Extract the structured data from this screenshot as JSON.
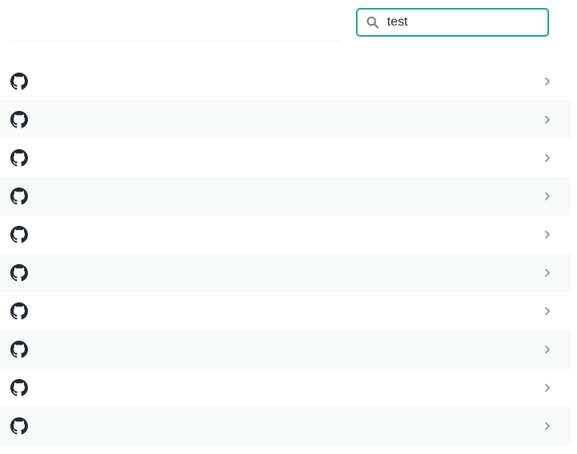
{
  "search": {
    "value": "test",
    "icon": "search-icon"
  },
  "repos": [
    {
      "name": "",
      "icon": "github-icon"
    },
    {
      "name": "",
      "icon": "github-icon"
    },
    {
      "name": "",
      "icon": "github-icon"
    },
    {
      "name": "",
      "icon": "github-icon"
    },
    {
      "name": "",
      "icon": "github-icon"
    },
    {
      "name": "",
      "icon": "github-icon"
    },
    {
      "name": "",
      "icon": "github-icon"
    },
    {
      "name": "",
      "icon": "github-icon"
    },
    {
      "name": "",
      "icon": "github-icon"
    },
    {
      "name": "",
      "icon": "github-icon"
    }
  ],
  "colors": {
    "accent": "#1ea698",
    "row_alt": "#f8f9f9",
    "icon": "#24292f",
    "chevron": "#9aa0a6"
  }
}
